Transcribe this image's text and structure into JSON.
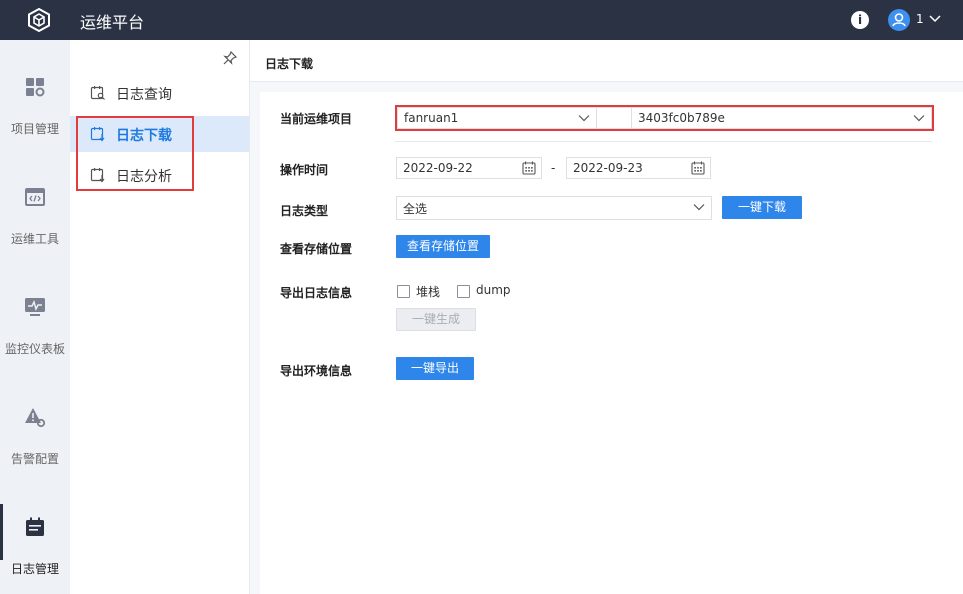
{
  "header": {
    "app_title": "运维平台",
    "user_name": "1"
  },
  "colors": {
    "topbar": "#2a3244",
    "accent": "#2f86ea",
    "highlight_box": "#e23b3b",
    "active_sub_bg": "#dce9fb"
  },
  "rail": [
    {
      "label": "项目管理",
      "icon": "grid-gear-icon"
    },
    {
      "label": "运维工具",
      "icon": "code-window-icon"
    },
    {
      "label": "监控仪表板",
      "icon": "monitor-pulse-icon"
    },
    {
      "label": "告警配置",
      "icon": "warning-gear-icon"
    },
    {
      "label": "日志管理",
      "icon": "calendar-log-icon",
      "active": true
    }
  ],
  "submenu": [
    {
      "label": "日志查询",
      "icon": "log-search-icon"
    },
    {
      "label": "日志下载",
      "icon": "log-download-icon",
      "active": true
    },
    {
      "label": "日志分析",
      "icon": "log-analysis-icon"
    }
  ],
  "page": {
    "title": "日志下载",
    "project": {
      "label": "当前运维项目",
      "name": "fanruan1",
      "node": "3403fc0b789e"
    },
    "time": {
      "label": "操作时间",
      "start": "2022-09-22",
      "separator": "-",
      "end": "2022-09-23"
    },
    "log_type": {
      "label": "日志类型",
      "value": "全选",
      "download_button": "一键下载"
    },
    "storage": {
      "label": "查看存储位置",
      "button": "查看存储位置"
    },
    "export_log": {
      "label": "导出日志信息",
      "options": [
        {
          "label": "堆栈",
          "checked": false
        },
        {
          "label": "dump",
          "checked": false
        }
      ],
      "generate_button": "一键生成"
    },
    "export_env": {
      "label": "导出环境信息",
      "button": "一键导出"
    }
  }
}
